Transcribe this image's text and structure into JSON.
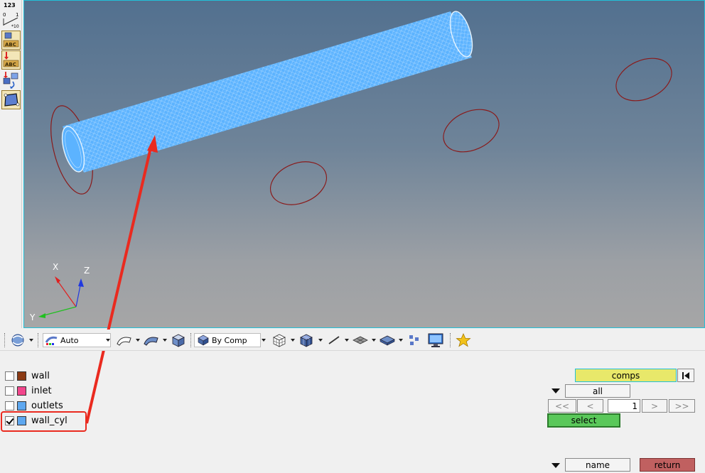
{
  "left_toolbar": {
    "ruler_label": "123",
    "tools": [
      "numbering-icon",
      "ruler-icon",
      "label-abc-icon",
      "label-abc-down-icon",
      "transfer-icon",
      "select-box-icon"
    ]
  },
  "viewport": {
    "axis_labels": {
      "x": "X",
      "y": "Y",
      "z": "Z"
    }
  },
  "toolbar": {
    "display_mode": "Auto",
    "color_by": "By Comp"
  },
  "components": [
    {
      "name": "wall",
      "color": "#8b3a14",
      "checked": false
    },
    {
      "name": "inlet",
      "color": "#f2468c",
      "checked": false
    },
    {
      "name": "outlets",
      "color": "#5ea8f0",
      "checked": false
    },
    {
      "name": "wall_cyl",
      "color": "#5ea8f0",
      "checked": true
    }
  ],
  "panel": {
    "entity_type": "comps",
    "filter": "all",
    "page_first": "<<",
    "page_prev": "<",
    "page_number": "1",
    "page_next": ">",
    "page_last": ">>",
    "select_label": "select",
    "sort_label": "name",
    "return_label": "return"
  },
  "colors": {
    "viewport_border": "#22c0d8",
    "mesh": "#5cb3ff",
    "annotation": "#ea2a1f",
    "comps_button": "#e8e86a",
    "select_button": "#5ac85a",
    "return_button": "#c06060"
  }
}
